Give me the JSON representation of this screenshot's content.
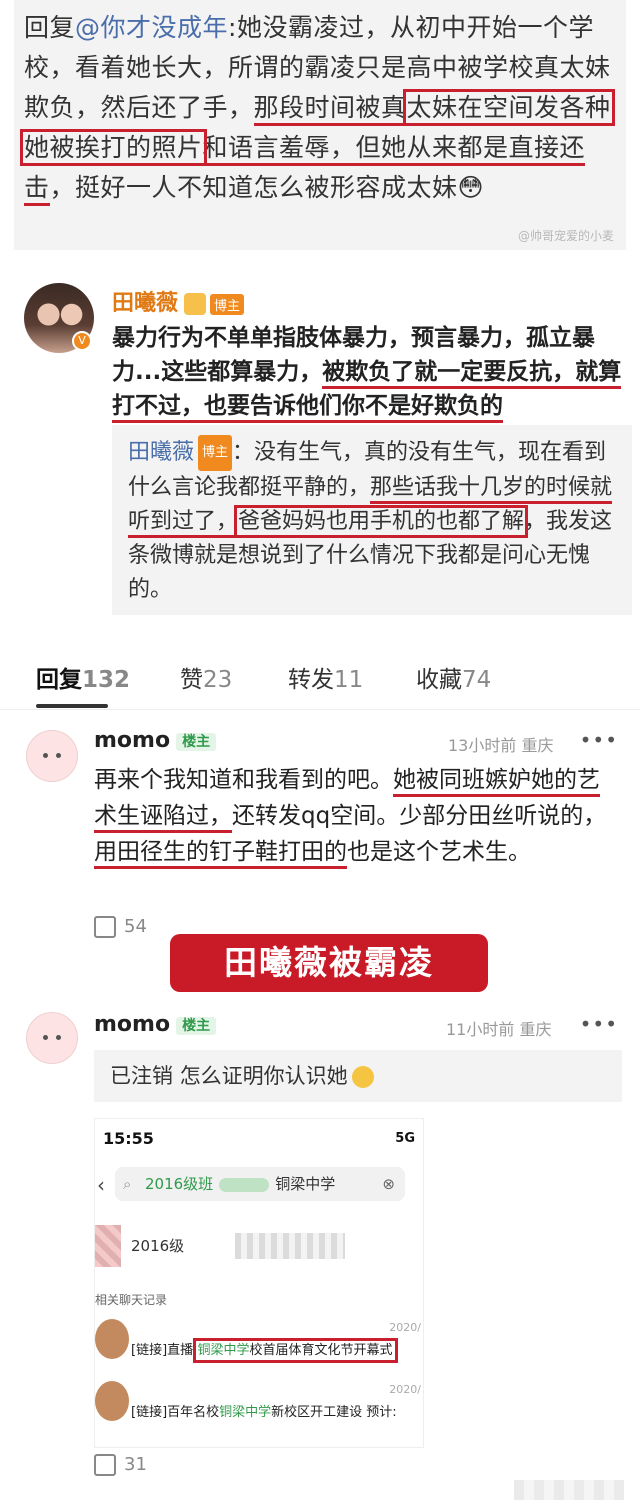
{
  "top_reply": {
    "prefix": "回复",
    "mention": "@你才没成年",
    "text_a": ":她没霸凌过，从初中开始一个学校，看着她长大，所谓的霸凌只是高中被学校真太妹欺负，然后还了手，",
    "text_b": "那段时间被真",
    "text_c": "太妹在空间发各种她被挨打的照片",
    "text_d": "和语言羞",
    "text_e": "辱，",
    "text_f": "但她从来都是直接还击",
    "text_g": "，挺好一人不知道怎么被形容成太妹😳",
    "watermark": "@帅哥宠爱的小麦"
  },
  "post1": {
    "name": "田曦薇",
    "badge": "博主",
    "body_a": "暴力行为不单单指肢体暴力，预言暴力，孤立暴力...这些都算暴力，",
    "body_b": "被欺负了就一定要反抗，",
    "body_c": "就算打不过，也要告诉他们你不是好欺负的",
    "quote_name": "田曦薇",
    "quote_badge": "博主",
    "quote_a": "：没有生气，真的没有生气，现在看到什么言论我都挺平静的，",
    "quote_b": "那些话我十几岁的时候就听到过了，",
    "quote_c": "爸爸妈妈也用手机的也都了解",
    "quote_d": "，我发这条微博就是想说到了什么情况下我都是问心无愧的。"
  },
  "tabs": [
    {
      "label": "回复",
      "count": "132"
    },
    {
      "label": "赞",
      "count": "23"
    },
    {
      "label": "转发",
      "count": "11"
    },
    {
      "label": "收藏",
      "count": "74"
    }
  ],
  "comment1": {
    "name": "momo",
    "tag": "楼主",
    "time": "13小时前 重庆",
    "more": "•••",
    "text_a": "再来个我知道和我看到的吧。",
    "text_b": "她被同班嫉妒她的艺术生诬陷过，",
    "text_c": "还转发qq空间。少部分田丝听说的，",
    "text_d": "用田径生的钉子鞋打田的",
    "text_e": "也是这个艺术生。",
    "likes": "54"
  },
  "banner": "田曦薇被霸凌",
  "comment2": {
    "name": "momo",
    "tag": "楼主",
    "time": "11小时前 重庆",
    "more": "•••",
    "quote_user": "已注销",
    "quote_text": "怎么证明你认识她",
    "likes": "31"
  },
  "shot": {
    "time": "15:55",
    "net": "5G",
    "search_prefix": "2016级班",
    "search_school": "铜梁中学",
    "row1": "2016级",
    "section": "相关聊天记录",
    "item1_date": "2020/",
    "item1_pre": "[链接]直播|",
    "item1_green": "铜梁中学",
    "item1_post": "校首届体育文化节开幕式",
    "item2_date": "2020/",
    "item2_pre": "[链接]百年名校",
    "item2_green": "铜梁中学",
    "item2_post": "新校区开工建设 预计:"
  }
}
